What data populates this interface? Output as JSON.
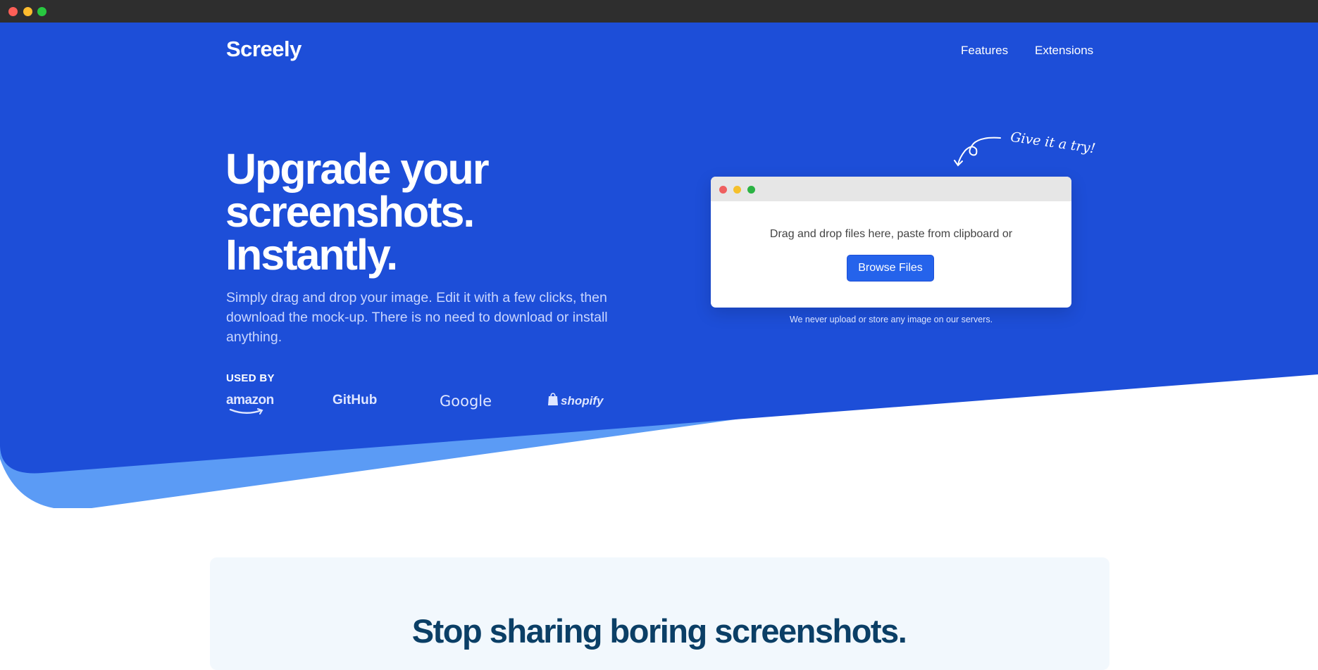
{
  "brand": {
    "name": "Screely"
  },
  "nav": {
    "features": "Features",
    "extensions": "Extensions"
  },
  "hero": {
    "headline": [
      "Upgrade your",
      "screenshots.",
      "Instantly."
    ],
    "subtext": "Simply drag and drop your image. Edit it with a few clicks, then download the mock-up. There is no need to download or install anything.",
    "used_by_label": "USED BY",
    "logos": [
      "amazon",
      "GitHub",
      "Google",
      "shopify"
    ]
  },
  "uploader": {
    "hint": "Give it a try!",
    "prompt": "Drag and drop files here, paste from clipboard or",
    "browse_label": "Browse Files",
    "privacy_note": "We never upload or store any image on our servers."
  },
  "section": {
    "title": "Stop sharing boring screenshots."
  },
  "colors": {
    "hero_blue": "#1d4ed8",
    "hero_wave": "#5b9bf5",
    "button_blue": "#2563eb",
    "section_title": "#0b3f66",
    "card_bg": "#f2f8fd",
    "window_bar": "#2e2e2e"
  }
}
